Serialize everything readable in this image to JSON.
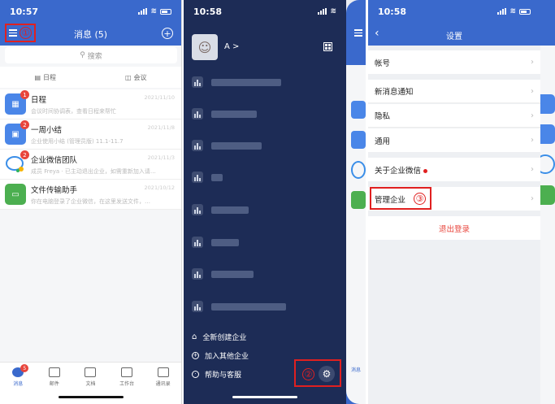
{
  "status": {
    "time1": "10:57",
    "time2": "10:58",
    "time3": "10:58"
  },
  "screen1": {
    "title": "消息 (5)",
    "step": "①",
    "search_placeholder": "搜索",
    "tab_schedule": "日程",
    "tab_meeting": "会议",
    "messages": [
      {
        "title": "日程",
        "sub": "会议时间协调表，查看日程来帮忙",
        "date": "2021/11/10",
        "badge": "1",
        "color": "#4a86e8"
      },
      {
        "title": "一周小结",
        "sub": "企业使用小结 (管理员版) 11.1-11.7",
        "date": "2021/11/8",
        "badge": "2",
        "color": "#4a86e8"
      },
      {
        "title": "企业微信团队",
        "sub": "成员 Freya · 已主动退出企业，如需重新加入请…",
        "date": "2021/11/3",
        "badge": "2",
        "color": "#ffffff"
      },
      {
        "title": "文件传输助手",
        "sub": "你在电脑登录了企业微信，在这里发送文件，…",
        "date": "2021/10/12",
        "badge": "",
        "color": "#2fb35f"
      }
    ],
    "tabbar": [
      {
        "label": "消息",
        "badge": "5"
      },
      {
        "label": "邮件",
        "badge": ""
      },
      {
        "label": "文档",
        "badge": ""
      },
      {
        "label": "工作台",
        "badge": ""
      },
      {
        "label": "通讯录",
        "badge": ""
      }
    ]
  },
  "screen2": {
    "user_name": "A >",
    "menu": [
      "全新创建企业",
      "加入其他企业",
      "帮助与客服"
    ],
    "step": "②",
    "peek_label": "消息"
  },
  "screen3": {
    "title": "设置",
    "rows": [
      "帐号",
      "新消息通知",
      "隐私",
      "通用",
      "关于企业微信",
      "管理企业"
    ],
    "step": "③",
    "logout": "退出登录"
  }
}
